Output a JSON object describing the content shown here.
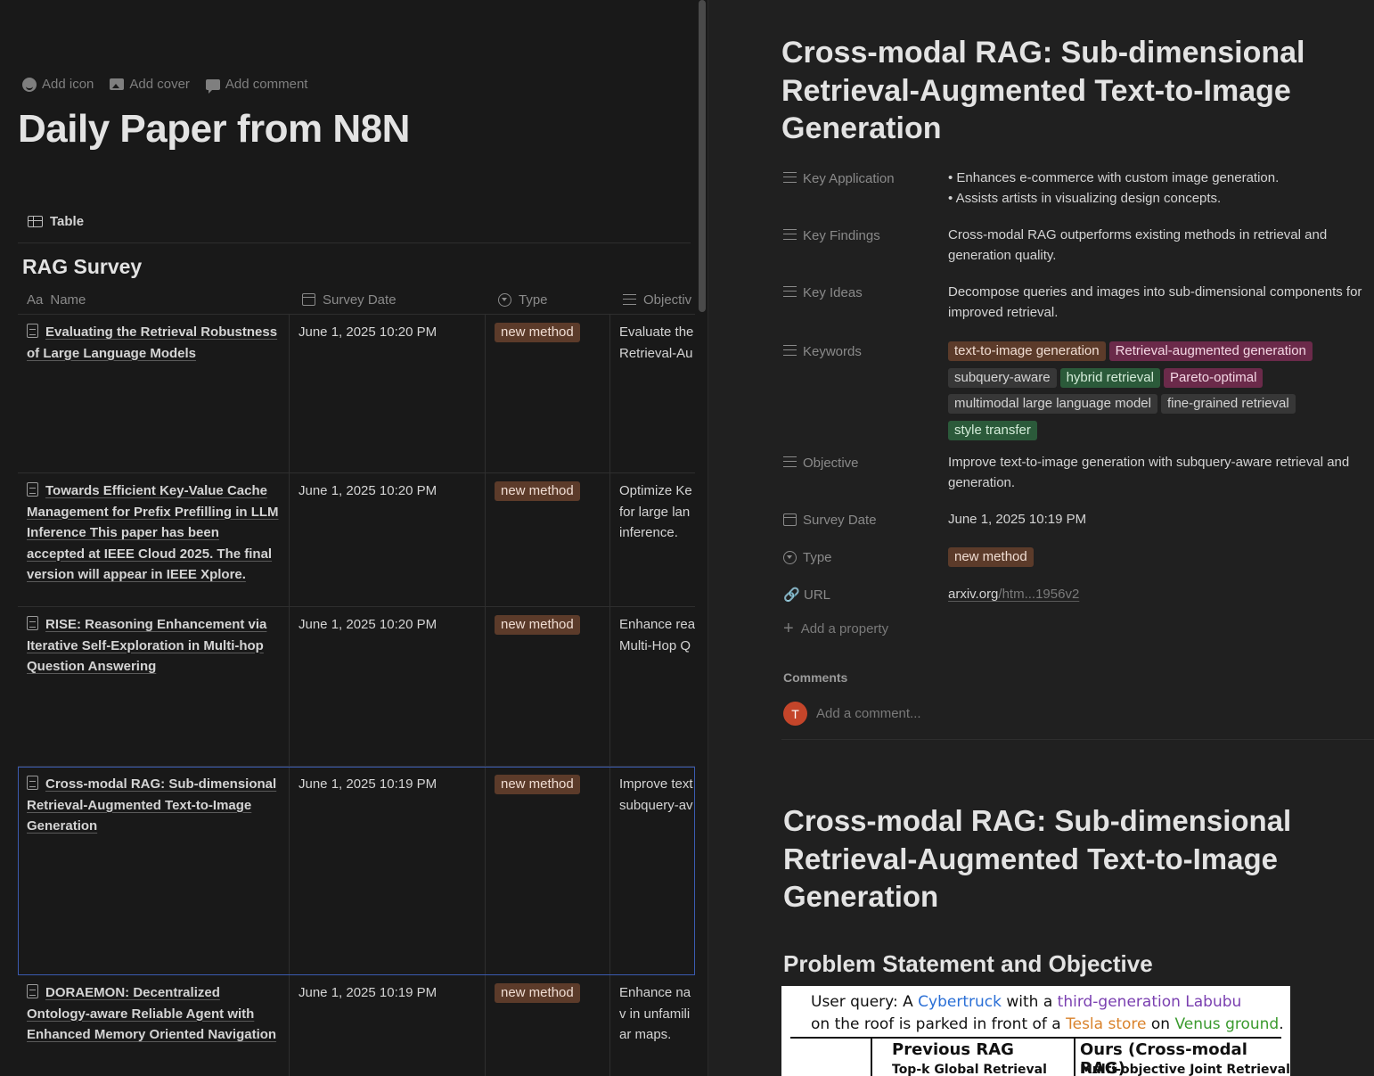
{
  "left": {
    "actions": [
      "Add icon",
      "Add cover",
      "Add comment"
    ],
    "title": "Daily Paper from N8N",
    "view_tab": "Table",
    "db_title": "RAG Survey",
    "columns": [
      "Name",
      "Survey Date",
      "Type",
      "Objectiv"
    ],
    "name_prefix": "Aa",
    "rows": [
      {
        "name": "Evaluating the Retrieval Robustness of Large Language Models",
        "date": "June 1, 2025 10:20 PM",
        "type": "new method",
        "objective": "Evaluate the Retrieval-Au"
      },
      {
        "name": "Towards Efficient Key-Value Cache Management for Prefix Prefilling in LLM Inference This paper has been accepted at IEEE Cloud 2025. The final version will appear in IEEE Xplore.",
        "date": "June 1, 2025 10:20 PM",
        "type": "new method",
        "objective": "Optimize Ke for large lan inference."
      },
      {
        "name": "RISE: Reasoning Enhancement via Iterative Self-Exploration in Multi-hop Question Answering",
        "date": "June 1, 2025 10:20 PM",
        "type": "new method",
        "objective": "Enhance rea Multi-Hop Q"
      },
      {
        "name": "Cross-modal RAG: Sub-dimensional Retrieval-Augmented Text-to-Image Generation",
        "date": "June 1, 2025 10:19 PM",
        "type": "new method",
        "objective": "Improve text subquery-av"
      },
      {
        "name": "DORAEMON: Decentralized Ontology-aware Reliable Agent with Enhanced Memory Oriented Navigation",
        "date": "June 1, 2025 10:19 PM",
        "type": "new method",
        "objective": "Enhance nav in unfamiliar maps."
      }
    ]
  },
  "right": {
    "title": "Cross-modal RAG: Sub-dimensional Retrieval-Augmented Text-to-Image Generation",
    "props": {
      "key_application": {
        "label": "Key Application",
        "bullets": [
          "Enhances e-commerce with custom image generation.",
          "Assists artists in visualizing design concepts."
        ]
      },
      "key_findings": {
        "label": "Key Findings",
        "value": "Cross-modal RAG outperforms existing methods in retrieval and generation quality."
      },
      "key_ideas": {
        "label": "Key Ideas",
        "value": "Decompose queries and images into sub-dimensional components for improved retrieval."
      },
      "keywords": {
        "label": "Keywords",
        "tags": [
          {
            "text": "text-to-image generation",
            "color": "#5c3b2a",
            "fg": "#f0ddd3"
          },
          {
            "text": "Retrieval-augmented generation",
            "color": "#6b2a4a",
            "fg": "#f3d6e3"
          },
          {
            "text": "subquery-aware",
            "color": "#373737",
            "fg": "#d4d4d4"
          },
          {
            "text": "hybrid retrieval",
            "color": "#2b5a3a",
            "fg": "#d4ecd9"
          },
          {
            "text": "Pareto-optimal",
            "color": "#6b2a4a",
            "fg": "#f3d6e3"
          },
          {
            "text": "multimodal large language model",
            "color": "#373737",
            "fg": "#d4d4d4"
          },
          {
            "text": "fine-grained retrieval",
            "color": "#373737",
            "fg": "#d4d4d4"
          },
          {
            "text": "style transfer",
            "color": "#2b5a3a",
            "fg": "#d4ecd9"
          }
        ]
      },
      "objective": {
        "label": "Objective",
        "value": "Improve text-to-image generation with subquery-aware retrieval and generation."
      },
      "survey_date": {
        "label": "Survey Date",
        "value": "June 1, 2025 10:19 PM"
      },
      "type": {
        "label": "Type",
        "value": "new method"
      },
      "url": {
        "label": "URL",
        "domain": "arxiv.org",
        "path": "/htm...1956v2"
      }
    },
    "add_property": "Add a property",
    "comments_heading": "Comments",
    "avatar_initial": "T",
    "comment_placeholder": "Add a comment...",
    "heading1": "Cross-modal RAG: Sub-dimensional Retrieval-Augmented Text-to-Image Generation",
    "heading2": "Problem Statement and Objective",
    "figure": {
      "query_prefix": "User query: A",
      "w1": "Cybertruck",
      "t1": "with a",
      "w2": "third-generation Labubu",
      "line2_pre": "on the roof is parked in front of a",
      "w3": "Tesla store",
      "t3": "on",
      "w4": "Venus ground",
      "t4": ".",
      "col1": "Previous RAG",
      "col1_sub": "Top-k Global Retrieval",
      "col2": "Ours (Cross-modal RAG)",
      "col2_sub": "Multi-objective Joint Retrieval"
    }
  }
}
